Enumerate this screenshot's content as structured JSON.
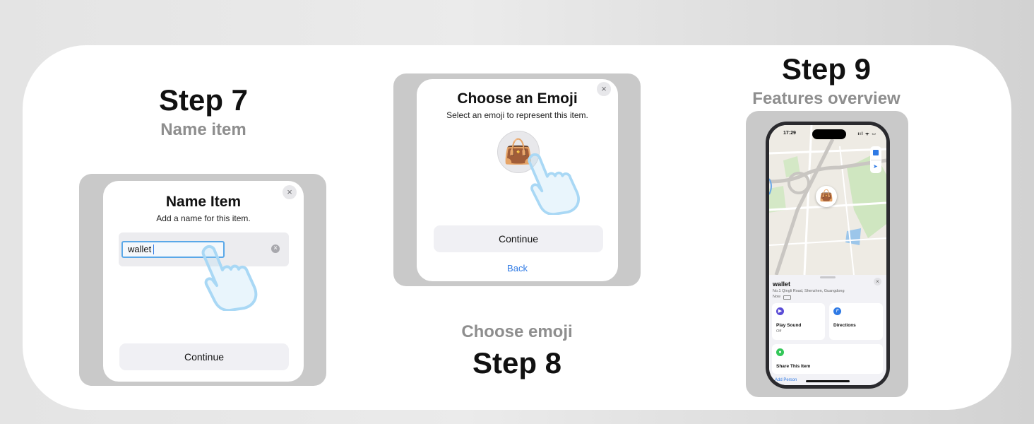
{
  "step7": {
    "title": "Step 7",
    "subtitle": "Name item",
    "dialog": {
      "title": "Name Item",
      "subtitle": "Add a name for this item.",
      "input_value": "wallet",
      "continue_label": "Continue",
      "close_icon": "×",
      "clear_icon": "×"
    }
  },
  "step8": {
    "title": "Step 8",
    "subtitle": "Choose emoji",
    "dialog": {
      "title": "Choose an Emoji",
      "subtitle": "Select an emoji to represent this item.",
      "emoji": "👜",
      "continue_label": "Continue",
      "back_label": "Back",
      "close_icon": "×"
    }
  },
  "step9": {
    "title": "Step 9",
    "subtitle": "Features overview",
    "phone": {
      "time": "17:29",
      "status_icons": "ııl ᯤ ▭",
      "map_emoji": "👜",
      "item_name": "wallet",
      "address": "No.1 Qingli Road, Shenzhen, Guangdong",
      "when": "Now",
      "close_icon": "×",
      "play_sound_label": "Play Sound",
      "play_sound_status": "Off",
      "directions_label": "Directions",
      "share_label": "Share This Item",
      "add_person_label": "Add Person"
    }
  },
  "colors": {
    "accent_blue": "#2f7ae5",
    "hand_outline": "#a9d8f5",
    "purple": "#5a4cd6",
    "green": "#34c759",
    "frame_gray": "#c9c9c9"
  }
}
